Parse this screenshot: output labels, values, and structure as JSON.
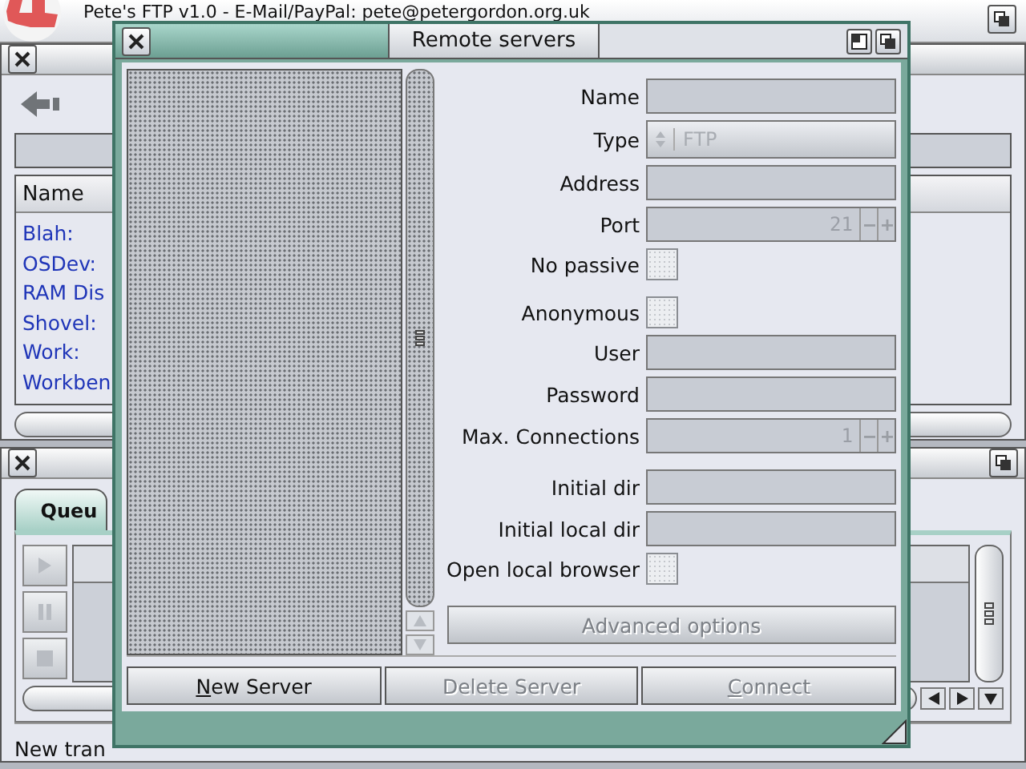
{
  "screen": {
    "title": "Pete's FTP v1.0 - E-Mail/PayPal: pete@petergordon.org.uk"
  },
  "browser_window": {
    "column_header": "Name",
    "items": [
      {
        "label": "Blah:"
      },
      {
        "label": "OSDev:"
      },
      {
        "label": "RAM Dis"
      },
      {
        "label": "Shovel:"
      },
      {
        "label": "Work:"
      },
      {
        "label": "Workben"
      }
    ]
  },
  "queue_window": {
    "tab": {
      "label": "Queu",
      "selected": true
    },
    "status": "New tran"
  },
  "dialog": {
    "title": "Remote servers",
    "form_groups": [
      [
        {
          "kind": "text",
          "label": "Name",
          "disabled": true
        },
        {
          "kind": "select",
          "label": "Type",
          "value": "FTP",
          "disabled": true
        },
        {
          "kind": "text",
          "label": "Address",
          "disabled": true
        },
        {
          "kind": "number",
          "label": "Port",
          "value": "21",
          "disabled": true
        },
        {
          "kind": "checkbox",
          "label": "No passive",
          "checked": false,
          "disabled": true
        }
      ],
      [
        {
          "kind": "checkbox",
          "label": "Anonymous",
          "checked": false,
          "disabled": true
        },
        {
          "kind": "text",
          "label": "User",
          "disabled": true
        },
        {
          "kind": "text",
          "label": "Password",
          "disabled": true
        },
        {
          "kind": "number",
          "label": "Max. Connections",
          "value": "1",
          "disabled": true
        }
      ],
      [
        {
          "kind": "text",
          "label": "Initial dir",
          "disabled": true
        },
        {
          "kind": "text",
          "label": "Initial local dir",
          "disabled": true
        },
        {
          "kind": "checkbox",
          "label": "Open local browser",
          "checked": false,
          "disabled": true
        }
      ]
    ],
    "advanced_button": {
      "label": "Advanced options",
      "disabled": true
    },
    "buttons": [
      {
        "label": "New Server",
        "underline_first": true,
        "disabled": false
      },
      {
        "label": "Delete Server",
        "underline_first": false,
        "disabled": true
      },
      {
        "label": "Connect",
        "underline_first": true,
        "disabled": true
      }
    ]
  }
}
